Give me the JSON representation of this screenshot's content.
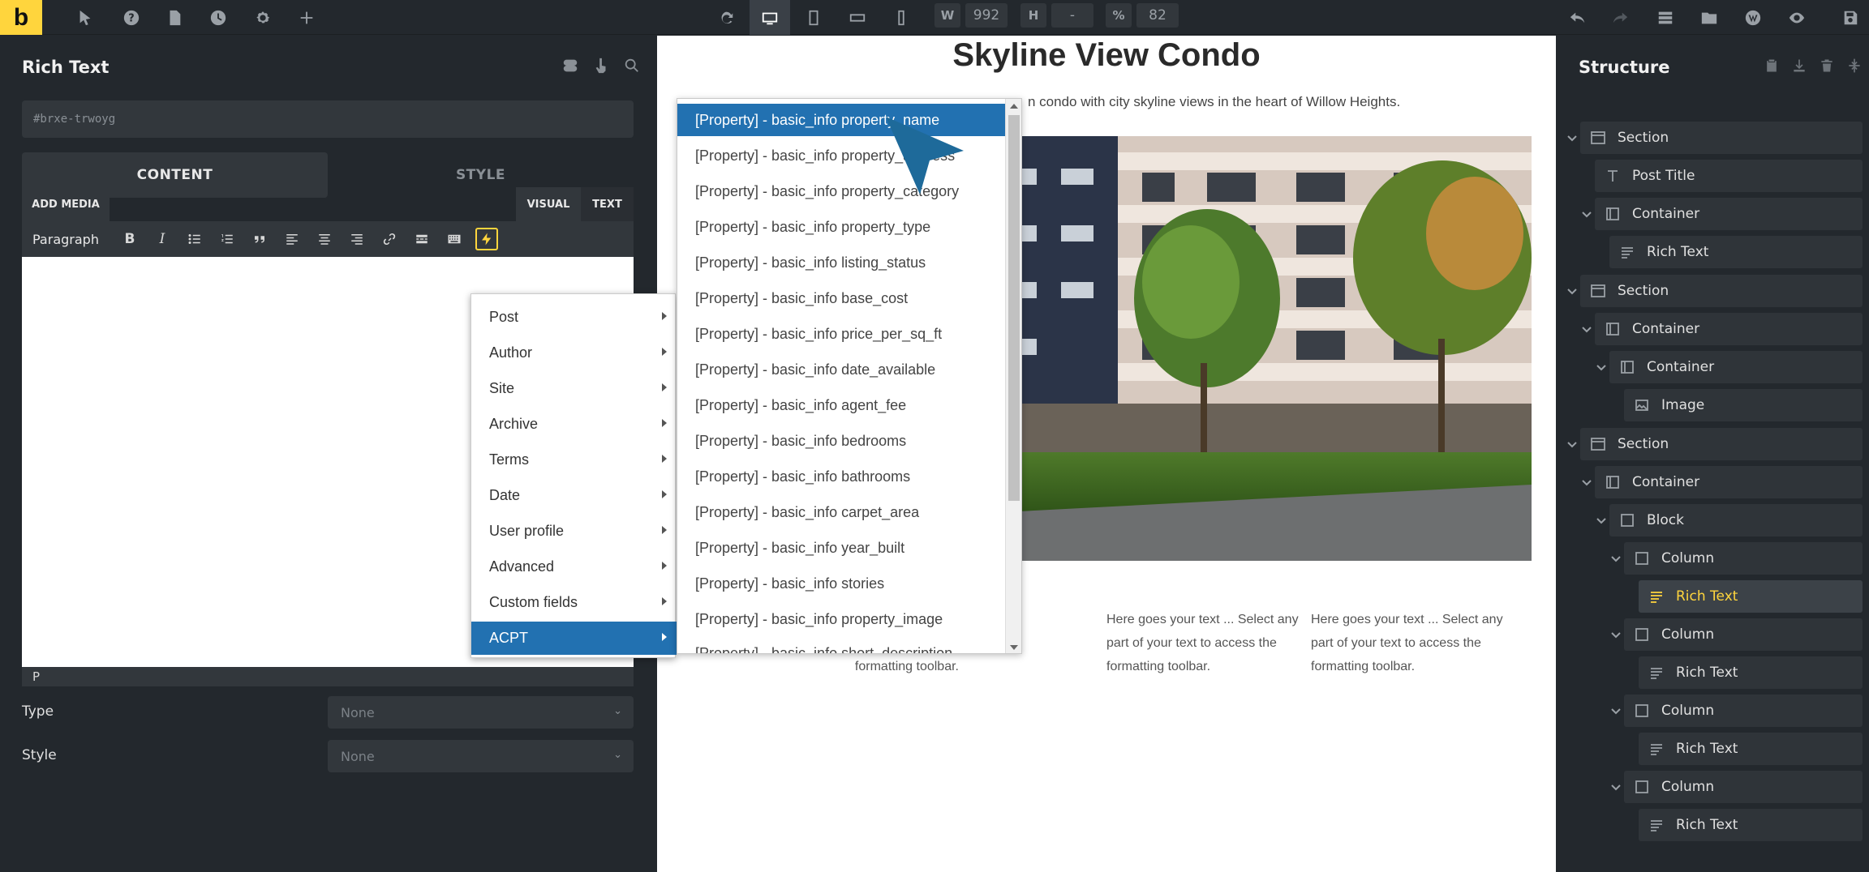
{
  "topbar": {
    "logo": "b",
    "width_label": "W",
    "width_value": "992",
    "height_label": "H",
    "height_value": "-",
    "zoom_label": "%",
    "zoom_value": "82"
  },
  "left_panel": {
    "title": "Rich Text",
    "element_id": "#brxe-trwoyg",
    "tabs": [
      "CONTENT",
      "STYLE"
    ],
    "add_media": "ADD MEDIA",
    "mode_tabs": [
      "VISUAL",
      "TEXT"
    ],
    "format_select": "Paragraph",
    "status_path": "P",
    "fields": [
      {
        "label": "Type",
        "value": "None"
      },
      {
        "label": "Style",
        "value": "None"
      }
    ]
  },
  "dynamic_menu": {
    "items": [
      "Post",
      "Author",
      "Site",
      "Archive",
      "Terms",
      "Date",
      "User profile",
      "Advanced",
      "Custom fields",
      "ACPT"
    ],
    "selected": "ACPT"
  },
  "acpt_submenu": {
    "items": [
      "[Property] - basic_info property_name",
      "[Property] - basic_info property_address",
      "[Property] - basic_info property_category",
      "[Property] - basic_info property_type",
      "[Property] - basic_info listing_status",
      "[Property] - basic_info base_cost",
      "[Property] - basic_info price_per_sq_ft",
      "[Property] - basic_info date_available",
      "[Property] - basic_info agent_fee",
      "[Property] - basic_info bedrooms",
      "[Property] - basic_info bathrooms",
      "[Property] - basic_info carpet_area",
      "[Property] - basic_info year_built",
      "[Property] - basic_info stories",
      "[Property] - basic_info property_image",
      "[Property] - basic_info short_description"
    ],
    "selected": "[Property] - basic_info property_name"
  },
  "canvas": {
    "title": "Skyline View Condo",
    "subtitle": "n condo with city skyline views in the heart of Willow Heights.",
    "columns": [
      "... Select any\naccess the\nformatting toolbar.",
      "Here goes your text ... Select any\npart of your text to access the\nformatting toolbar.",
      "Here goes your text ... Select any\npart of your text to access the\nformatting toolbar."
    ]
  },
  "structure": {
    "title": "Structure",
    "nodes": [
      {
        "label": "Section",
        "icon": "section-icon"
      },
      {
        "label": "Post Title",
        "icon": "text-icon"
      },
      {
        "label": "Container",
        "icon": "container-icon"
      },
      {
        "label": "Rich Text",
        "icon": "richtext-icon"
      },
      {
        "label": "Section",
        "icon": "section-icon"
      },
      {
        "label": "Container",
        "icon": "container-icon"
      },
      {
        "label": "Container",
        "icon": "container-icon"
      },
      {
        "label": "Image",
        "icon": "image-icon"
      },
      {
        "label": "Section",
        "icon": "section-icon"
      },
      {
        "label": "Container",
        "icon": "container-icon"
      },
      {
        "label": "Block",
        "icon": "block-icon"
      },
      {
        "label": "Column",
        "icon": "block-icon"
      },
      {
        "label": "Rich Text",
        "icon": "richtext-icon"
      },
      {
        "label": "Column",
        "icon": "block-icon"
      },
      {
        "label": "Rich Text",
        "icon": "richtext-icon"
      },
      {
        "label": "Column",
        "icon": "block-icon"
      },
      {
        "label": "Rich Text",
        "icon": "richtext-icon"
      },
      {
        "label": "Column",
        "icon": "block-icon"
      },
      {
        "label": "Rich Text",
        "icon": "richtext-icon"
      }
    ],
    "active_node": "Rich Text"
  },
  "colors": {
    "accent": "#ffd53d",
    "selection": "#2271b1",
    "panel_bg": "#23282d"
  }
}
